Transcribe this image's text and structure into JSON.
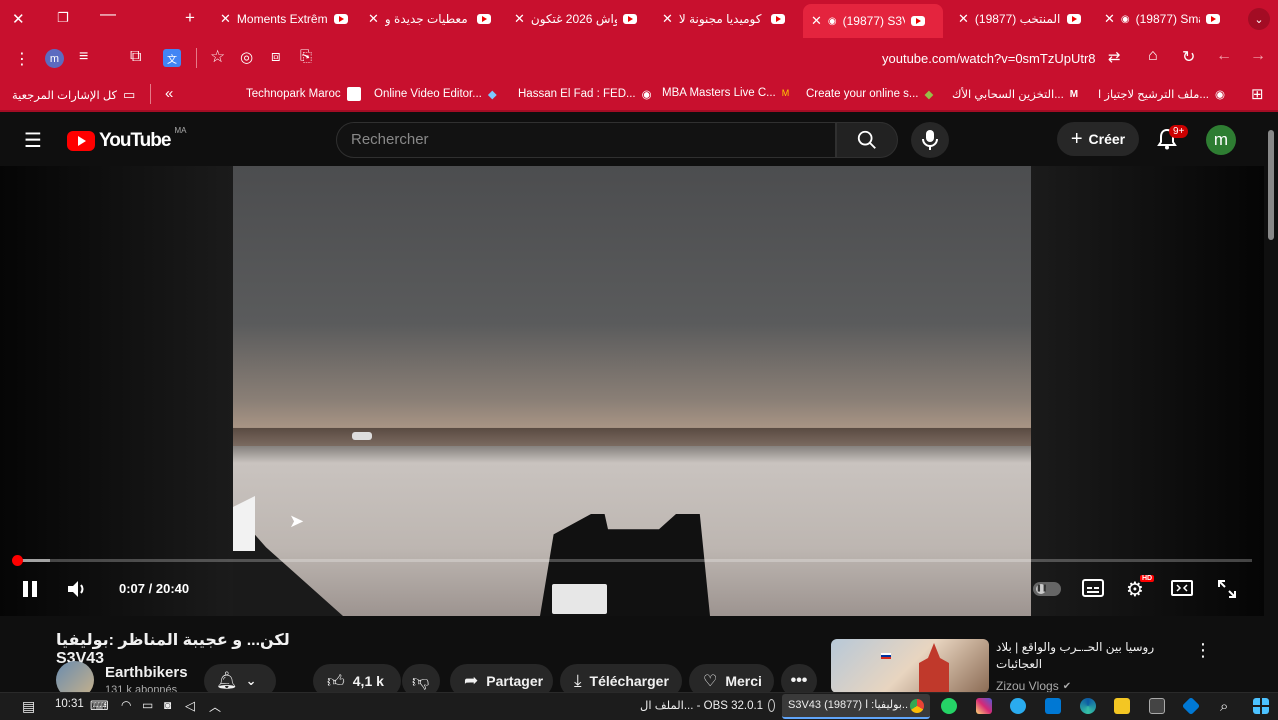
{
  "browser": {
    "tabs": [
      {
        "title": "Moments Extrêm",
        "active": false
      },
      {
        "title": "معطيات جديدة و",
        "active": false
      },
      {
        "title": "واش 2026 غتكون",
        "active": false
      },
      {
        "title": "كوميديا مجنونة لا",
        "active": false
      },
      {
        "title": "(19877) S3V",
        "active": true
      },
      {
        "title": "(19877) المنتخب",
        "active": false
      },
      {
        "title": "(19877) Sma",
        "active": false
      }
    ],
    "url": "youtube.com/watch?v=0smTzUpUtr8",
    "profile_initial": "m",
    "bookmarks": [
      {
        "label": "ملف الترشيح لاجتياز ا..."
      },
      {
        "label": "التخزين السحابي الأك..."
      },
      {
        "label": "Create your online s..."
      },
      {
        "label": "MBA Masters Live C..."
      },
      {
        "label": "Hassan El Fad : FED..."
      },
      {
        "label": "Online Video Editor..."
      },
      {
        "label": "Technopark Maroc"
      }
    ],
    "all_bookmarks_label": "كل الإشارات المرجعية"
  },
  "youtube": {
    "logo_text": "YouTube",
    "country_code": "MA",
    "search_placeholder": "Rechercher",
    "create_label": "Créer",
    "notif_count": "9+",
    "avatar_initial": "m"
  },
  "player": {
    "time_current": "0:07",
    "time_separator": " / ",
    "time_total": "20:40",
    "progress_fraction": 0.006,
    "hd_badge": "HD"
  },
  "video": {
    "title": "لكن... و عجيبة المناظر :بوليفيا S3V43",
    "channel_name": "Earthbikers",
    "subscribers": "131 k abonnés",
    "likes": "4,1 k",
    "share_label": "Partager",
    "download_label": "Télécharger",
    "thanks_label": "Merci"
  },
  "recommendation": {
    "title": "روسيا بين الحـ.ـرب والواقع | بلاد العجائبات",
    "channel": "Zizou Vlogs"
  },
  "taskbar": {
    "time": "10:31",
    "items": [
      {
        "label": "الملف ال... - OBS 32.0.1"
      },
      {
        "label": "S3V43 (19877) بوليفيا: ا..."
      }
    ]
  },
  "colors": {
    "browser_red": "#c8102e",
    "youtube_bg": "#0f0f0f",
    "accent_red": "#ff0000",
    "avatar_green": "#2e7d32"
  }
}
